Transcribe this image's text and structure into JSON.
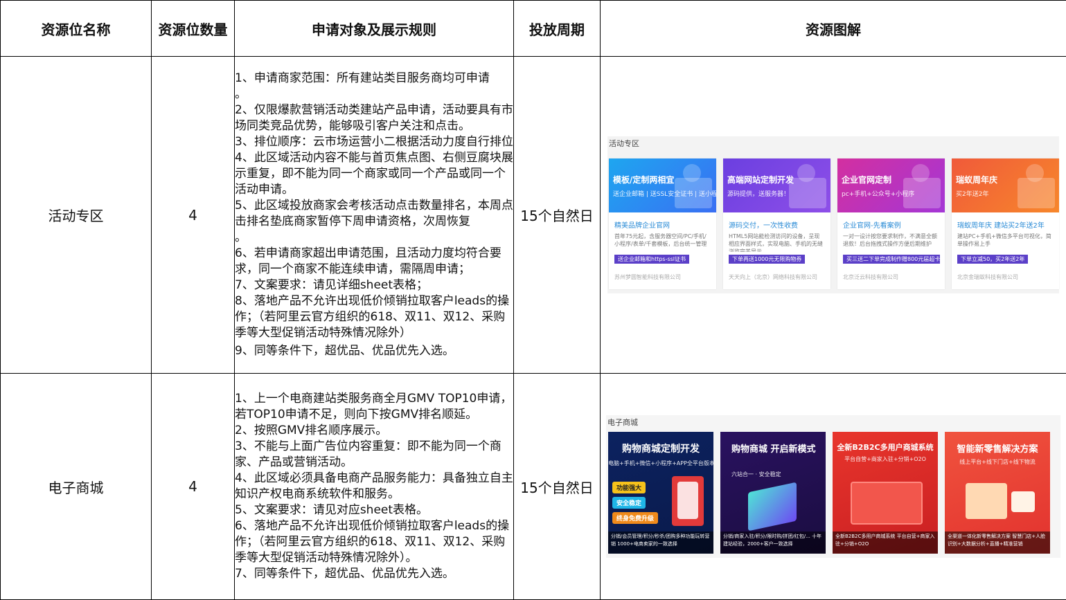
{
  "headers": [
    "资源位名称",
    "资源位数量",
    "申请对象及展示规则",
    "投放周期",
    "资源图解"
  ],
  "rows": [
    {
      "name": "活动专区",
      "count": "4",
      "period": "15个自然日",
      "rules": [
        "1、申请商家范围：所有建站类目服务商均可申请",
        "。",
        "2、仅限爆款营销活动类建站产品申请，活动要具有市场同类竞品优势，能够吸引客户关注和点击。",
        "3、排位顺序：云市场运营小二根据活动力度自行排位",
        "4、此区域活动内容不能与首页焦点图、右侧豆腐块展示重复，即不能为同一个商家或同一个产品或同一个活动申请。",
        "5、此区域投放商家会考核活动点击数量排名，本周点击排名垫底商家暂停下周申请资格，次周恢复",
        "。",
        "6、若申请商家超出申请范围，且活动力度均符合要求，同一个商家不能连续申请，需隔周申请；",
        "7、文案要求：请见详细sheet表格；",
        "8、落地产品不允许出现低价倾销拉取客户leads的操作；（若阿里云官方组织的618、双11、双12、采购季等大型促销活动特殊情况除外）",
        "9、同等条件下，超优品、优品优先入选。"
      ],
      "preview": {
        "title": "活动专区",
        "cards": [
          {
            "banner_title": "模板/定制两相宜",
            "banner_sub": "送企业邮箱 | 送SSL安全证书 | 送小程序",
            "title": "精美品牌企业官网",
            "desc": "首年75元起，含服务器空间/PC/手机/小程序/表单/千套模板，后台统一管理",
            "tag": "送企业邮箱和https-ssl证书",
            "company": "苏州梦圆智能科技有限公司"
          },
          {
            "banner_title": "高端网站定制开发",
            "banner_sub": "源码提供，送服务器！",
            "title": "源码交付，一次性收费",
            "desc": "HTML5网站能检测访问的设备，呈现相应界面样式，实现电脑、手机的无缝浏览完美显示",
            "tag": "下单再送1000元无限购物券",
            "company": "天天向上（北京）网络科技有限公司"
          },
          {
            "banner_title": "企业官网定制",
            "banner_sub": "pc+手机+公众号+小程序",
            "title": "企业官网-先看案例",
            "desc": "一对一设计按您要求制作，不满意全额退款！后台拖拽式操作方便后期维护",
            "tag": "买三送二下单完成制作赠800元届超卡",
            "company": "北京泛云科技有限公司"
          },
          {
            "banner_title": "瑞蚁周年庆",
            "banner_sub": "买2年送2年",
            "title": "瑞蚁周年庆 建站买2年送2年",
            "desc": "建站PC+手机+微信多平台可视化，简单操作易上手",
            "tag": "下单立减50，买2年送2年",
            "company": "北京金瑞蚁科技有限公司"
          }
        ]
      }
    },
    {
      "name": "电子商城",
      "count": "4",
      "period": "15个自然日",
      "rules": [
        "1、上一个电商建站类服务商全月GMV TOP10申请，若TOP10申请不足，则向下按GMV排名顺延。",
        "2、按照GMV排名顺序展示。",
        "3、不能与上面广告位内容重复：即不能为同一个商家、产品或营销活动。",
        "4、此区域必须具备电商产品服务能力：具备独立自主知识产权电商系统软件和服务。",
        "5、文案要求：请见对应sheet表格。",
        "6、落地产品不允许出现低价倾销拉取客户leads的操作；（若阿里云官方组织的618、双11、双12、采购季等大型促销活动特殊情况除外）。",
        "7、同等条件下，超优品、优品优先入选。"
      ],
      "preview": {
        "title": "电子商城",
        "cards": [
          {
            "title": "购物商城定制开发",
            "sub": "电脑+手机+微信+小程序+APP全平台版本",
            "pills": [
              "功能强大",
              "安全稳定",
              "终身免费升级"
            ],
            "footer": "分销/会员管理/积分/秒杀/团购多种功能玩转营销 1000+电商卖家的一致选择"
          },
          {
            "title": "购物商城 开启新模式",
            "sub": "六站合一 · 安全稳定",
            "footer": "分销/商家入驻/积分/限时购/拼团/红包/... 十年建站经验，2000+客户一致选择"
          },
          {
            "title": "全新B2B2C多用户商城系统",
            "sub": "平台自营+商家入驻+分销+O2O",
            "footer": "全新B2B2C多用户商城系统 平台自营+商家入驻+分销+O2O"
          },
          {
            "title": "智能新零售解决方案",
            "sub": "线上平台+线下门店+线下物流",
            "footer": "全渠道一体化新零售解决方案 智慧门店+人脸识别+大数据分析+直播+精准营销"
          }
        ]
      }
    }
  ]
}
